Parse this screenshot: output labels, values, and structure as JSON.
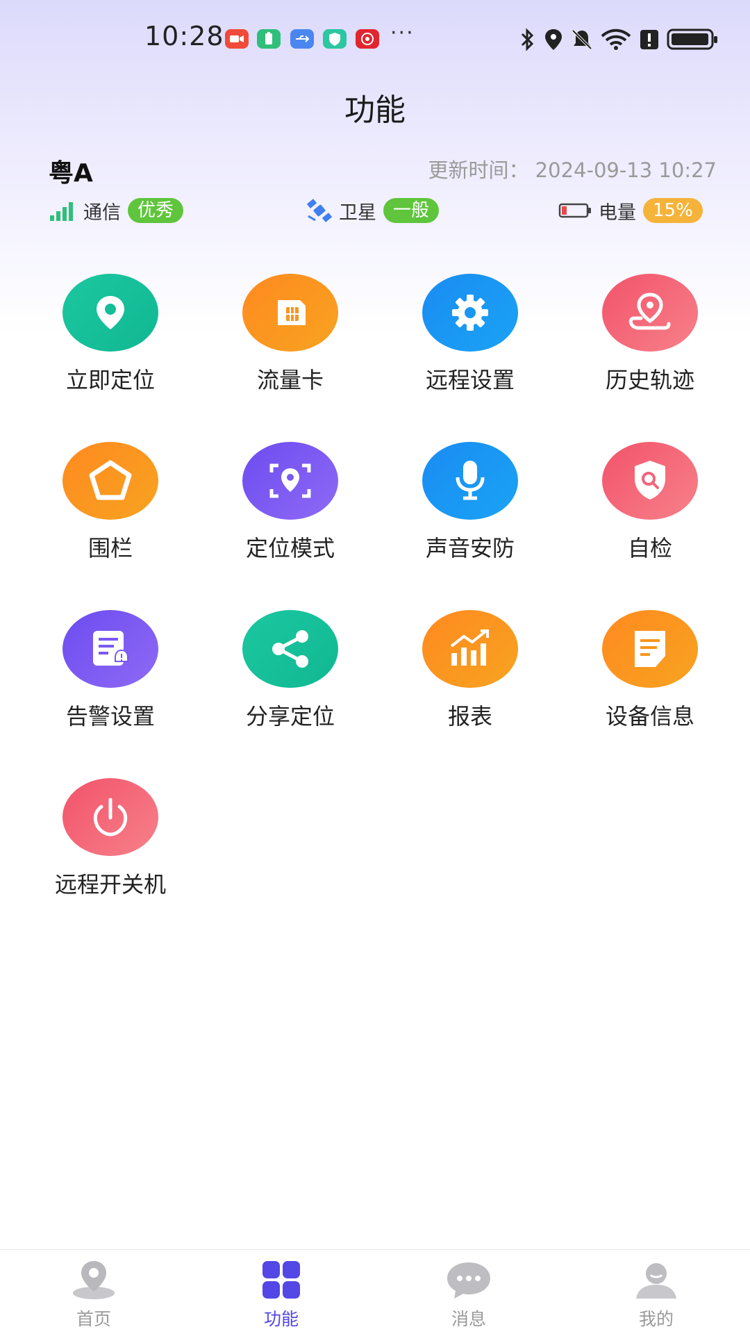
{
  "status_bar": {
    "time": "10:28",
    "more": "···"
  },
  "header": {
    "title": "功能"
  },
  "device": {
    "plate": "粤A",
    "update_label": "更新时间：",
    "update_time": "2024-09-13 10:27",
    "signal": {
      "label": "通信",
      "status": "优秀"
    },
    "satellite": {
      "label": "卫星",
      "status": "一般"
    },
    "battery": {
      "label": "电量",
      "status": "15%"
    }
  },
  "features": [
    {
      "label": "立即定位",
      "icon": "location-pin-icon"
    },
    {
      "label": "流量卡",
      "icon": "sim-card-icon"
    },
    {
      "label": "远程设置",
      "icon": "gear-icon"
    },
    {
      "label": "历史轨迹",
      "icon": "track-history-icon"
    },
    {
      "label": "围栏",
      "icon": "fence-icon"
    },
    {
      "label": "定位模式",
      "icon": "location-mode-icon"
    },
    {
      "label": "声音安防",
      "icon": "microphone-icon"
    },
    {
      "label": "自检",
      "icon": "self-check-shield-icon"
    },
    {
      "label": "告警设置",
      "icon": "alarm-settings-icon"
    },
    {
      "label": "分享定位",
      "icon": "share-icon"
    },
    {
      "label": "报表",
      "icon": "report-chart-icon"
    },
    {
      "label": "设备信息",
      "icon": "device-info-icon"
    },
    {
      "label": "远程开关机",
      "icon": "power-icon"
    }
  ],
  "bottom_nav": [
    {
      "label": "首页",
      "icon": "home-location-icon",
      "active": false
    },
    {
      "label": "功能",
      "icon": "grid-apps-icon",
      "active": true
    },
    {
      "label": "消息",
      "icon": "message-bubble-icon",
      "active": false
    },
    {
      "label": "我的",
      "icon": "profile-icon",
      "active": false
    }
  ],
  "colors": {
    "accent": "#5347e6",
    "green_badge": "#5fc53c",
    "orange_badge": "#f5b33a"
  }
}
